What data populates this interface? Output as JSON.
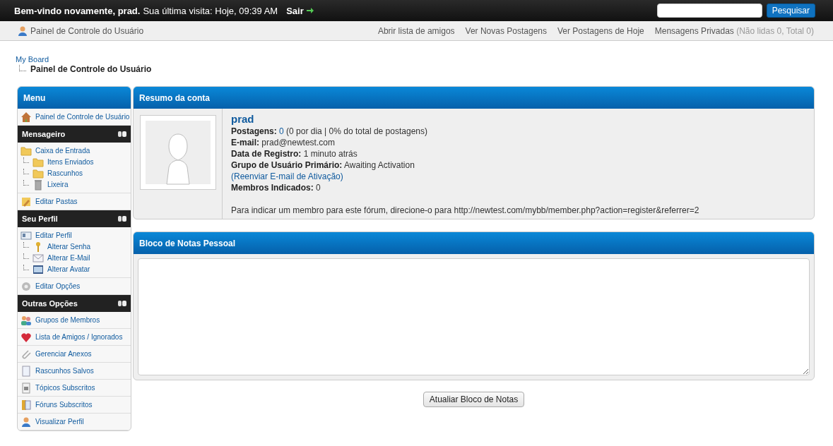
{
  "top_bar": {
    "welcome": "Bem-vindo novamente, prad.",
    "last_visit": "Sua última visita: Hoje, 09:39 AM",
    "logout": "Sair",
    "search_button": "Pesquisar"
  },
  "nav_bar": {
    "title": "Painel de Controle do Usuário",
    "links": [
      {
        "label": "Abrir lista de amigos"
      },
      {
        "label": "Ver Novas Postagens"
      },
      {
        "label": "Ver Postagens de Hoje"
      },
      {
        "label": "Mensagens Privadas",
        "note": "(Não lidas 0, Total 0)"
      }
    ]
  },
  "breadcrumb": {
    "root": "My Board",
    "current": "Painel de Controle do Usuário"
  },
  "sidebar": {
    "title": "Menu",
    "groups": [
      {
        "entries": [
          {
            "label": "Painel de Controle de Usuário"
          }
        ]
      },
      {
        "heading": "Mensageiro",
        "entries": [
          {
            "label": "Caixa de Entrada",
            "children": [
              {
                "label": "Itens Enviados"
              },
              {
                "label": "Rascunhos"
              },
              {
                "label": "Lixeira"
              }
            ]
          },
          {
            "label": "Editar Pastas"
          }
        ]
      },
      {
        "heading": "Seu Perfil",
        "entries": [
          {
            "label": "Editar Perfil",
            "children": [
              {
                "label": "Alterar Senha"
              },
              {
                "label": "Alterar E-Mail"
              },
              {
                "label": "Alterar Avatar"
              }
            ]
          },
          {
            "label": "Editar Opções"
          }
        ]
      },
      {
        "heading": "Outras Opções",
        "entries": [
          {
            "label": "Grupos de Membros"
          },
          {
            "label": "Lista de Amigos / Ignorados"
          },
          {
            "label": "Gerenciar Anexos"
          },
          {
            "label": "Rascunhos Salvos"
          },
          {
            "label": "Tópicos Subscritos"
          },
          {
            "label": "Fóruns Subscritos"
          },
          {
            "label": "Visualizar Perfil"
          }
        ]
      }
    ]
  },
  "account": {
    "title": "Resumo da conta",
    "username": "prad",
    "fields": [
      {
        "label": "Postagens:",
        "link": "0",
        "value": "(0 por dia | 0% do total de postagens)"
      },
      {
        "label": "E-mail:",
        "value": "prad@newtest.com"
      },
      {
        "label": "Data de Registro:",
        "value": "1 minuto atrás"
      },
      {
        "label": "Grupo de Usuário Primário:",
        "value": "Awaiting Activation"
      }
    ],
    "resend_link": "(Reenviar E-mail de Ativação)",
    "referrals": {
      "label": "Membros Indicados:",
      "value": "0"
    },
    "referral_text": "Para indicar um membro para este fórum, direcione-o para http://newtest.com/mybb/member.php?action=register&referrer=2"
  },
  "notepad": {
    "title": "Bloco de Notas Pessoal",
    "button": "Atualiar Bloco de Notas"
  }
}
